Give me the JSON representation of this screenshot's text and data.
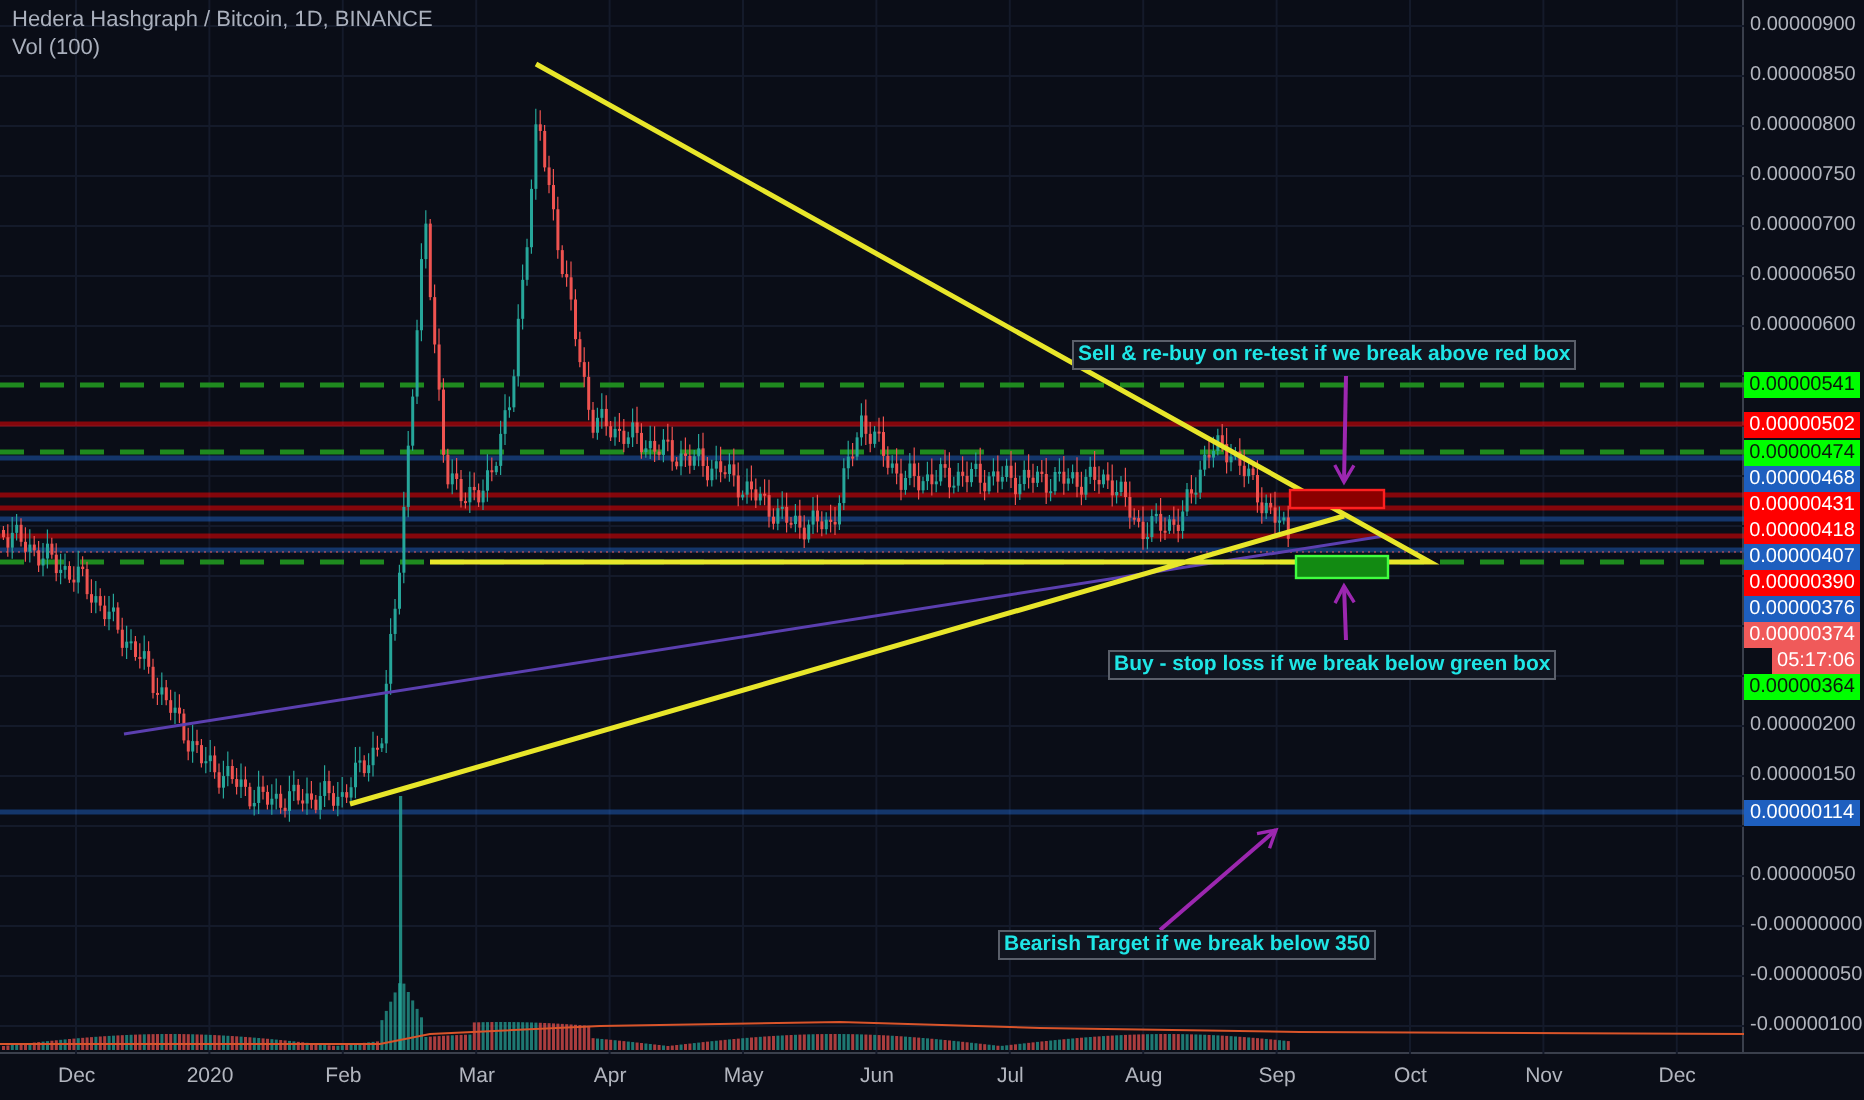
{
  "header": {
    "title": "Hedera Hashgraph / Bitcoin, 1D, BINANCE",
    "indicator": "Vol (100)"
  },
  "price_axis": {
    "ticks": [
      "0.00000900",
      "0.00000850",
      "0.00000800",
      "0.00000750",
      "0.00000700",
      "0.00000650",
      "0.00000600",
      "0.00000200",
      "0.00000150",
      "0.00000050",
      "-0.00000000",
      "-0.00000050",
      "-0.00000100"
    ]
  },
  "price_labels": [
    {
      "kind": "dashed",
      "text": "0.00000541",
      "color": "#00ff00"
    },
    {
      "kind": "solid",
      "text": "0.00000502",
      "color": "#ff0000"
    },
    {
      "kind": "dashed",
      "text": "0.00000474",
      "color": "#00ff00"
    },
    {
      "kind": "solid",
      "text": "0.00000468",
      "color": "#1e5fbf"
    },
    {
      "kind": "solid",
      "text": "0.00000431",
      "color": "#ff0000"
    },
    {
      "kind": "solid",
      "text": "0.00000418",
      "color": "#ff0000"
    },
    {
      "kind": "solid",
      "text": "0.00000407",
      "color": "#1e5fbf"
    },
    {
      "kind": "solid",
      "text": "0.00000390",
      "color": "#ff0000"
    },
    {
      "kind": "solid",
      "text": "0.00000376",
      "color": "#1e5fbf"
    },
    {
      "kind": "dotted",
      "text": "0.00000374",
      "color": "#f05a5a"
    },
    {
      "kind": "countdown",
      "text": "05:17:06",
      "color": "#f05a5a"
    },
    {
      "kind": "dashed",
      "text": "0.00000364",
      "color": "#00ff00"
    },
    {
      "kind": "solid",
      "text": "0.00000114",
      "color": "#1e5fbf"
    }
  ],
  "annotations": [
    {
      "kind": "sell",
      "text": "Sell & re-buy on re-test if we break above red box"
    },
    {
      "kind": "buy",
      "text": "Buy - stop loss if we break below green box"
    },
    {
      "kind": "bearish",
      "text": "Bearish Target if we break below 350"
    }
  ],
  "time_axis": {
    "labels": [
      "Dec",
      "2020",
      "Feb",
      "Mar",
      "Apr",
      "May",
      "Jun",
      "Jul",
      "Aug",
      "Sep",
      "Oct",
      "Nov",
      "Dec"
    ]
  }
}
